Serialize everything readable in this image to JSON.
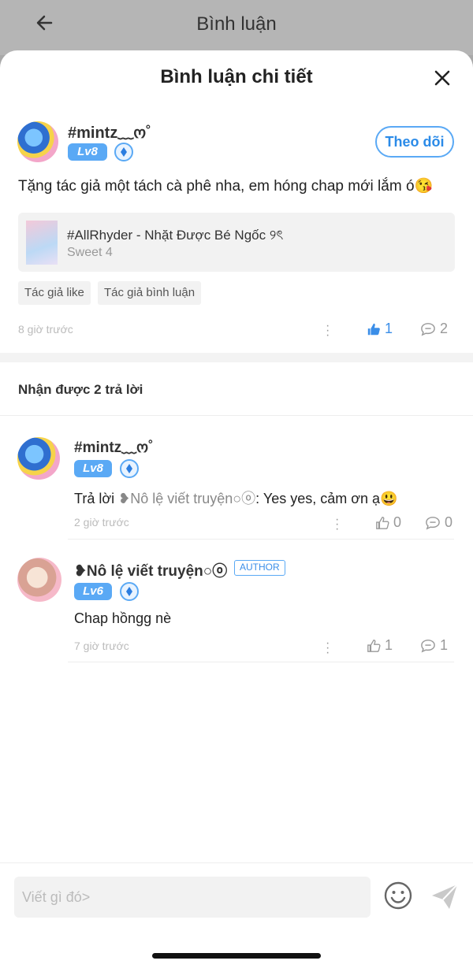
{
  "header": {
    "title": "Bình luận"
  },
  "sheet": {
    "title": "Bình luận chi tiết"
  },
  "main_comment": {
    "username": "#mintz﹏ო˚",
    "level": "Lv8",
    "follow_label": "Theo dõi",
    "text": "Tặng tác giả một tách cà phê nha, em hóng chap mới lắm ó😘",
    "story": {
      "title": "#AllRhyder - Nhặt Được Bé Ngốc ୨ৎ",
      "chapter": "Sweet 4"
    },
    "tags": [
      "Tác giả like",
      "Tác giả bình luận"
    ],
    "time": "8 giờ trước",
    "likes": "1",
    "replies": "2"
  },
  "replies_header": "Nhận được 2 trả lời",
  "replies": [
    {
      "username": "#mintz﹏ო˚",
      "level": "Lv8",
      "reply_prefix": "Trả lời",
      "reply_to": "❥Nô lệ viết truyện○ⓞ",
      "text": ": Yes yes, cảm ơn ạ😃",
      "time": "2 giờ trước",
      "likes": "0",
      "replies": "0"
    },
    {
      "username": "❥Nô lệ viết truyện○ⓞ",
      "author_badge": "AUTHOR",
      "level": "Lv6",
      "text": "Chap hồngg nè",
      "time": "7 giờ trước",
      "likes": "1",
      "replies": "1"
    }
  ],
  "composer": {
    "placeholder": "Viết gì đó>"
  },
  "colors": {
    "accent": "#5aa9f5",
    "like_active": "#3b8ee8"
  }
}
